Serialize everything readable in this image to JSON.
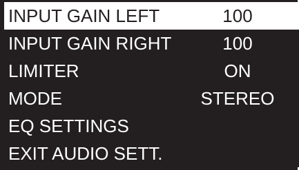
{
  "menu": {
    "items": [
      {
        "label": "INPUT GAIN LEFT",
        "value": "100"
      },
      {
        "label": "INPUT GAIN RIGHT",
        "value": "100"
      },
      {
        "label": "LIMITER",
        "value": "ON"
      },
      {
        "label": "MODE",
        "value": "STEREO"
      },
      {
        "label": "EQ SETTINGS",
        "value": ""
      },
      {
        "label": "EXIT AUDIO SETT.",
        "value": ""
      }
    ],
    "selected_index": 0
  },
  "colors": {
    "background": "#231f20",
    "text": "#ffffff",
    "highlight": "#ffffff",
    "highlight_text": "#231f20"
  }
}
